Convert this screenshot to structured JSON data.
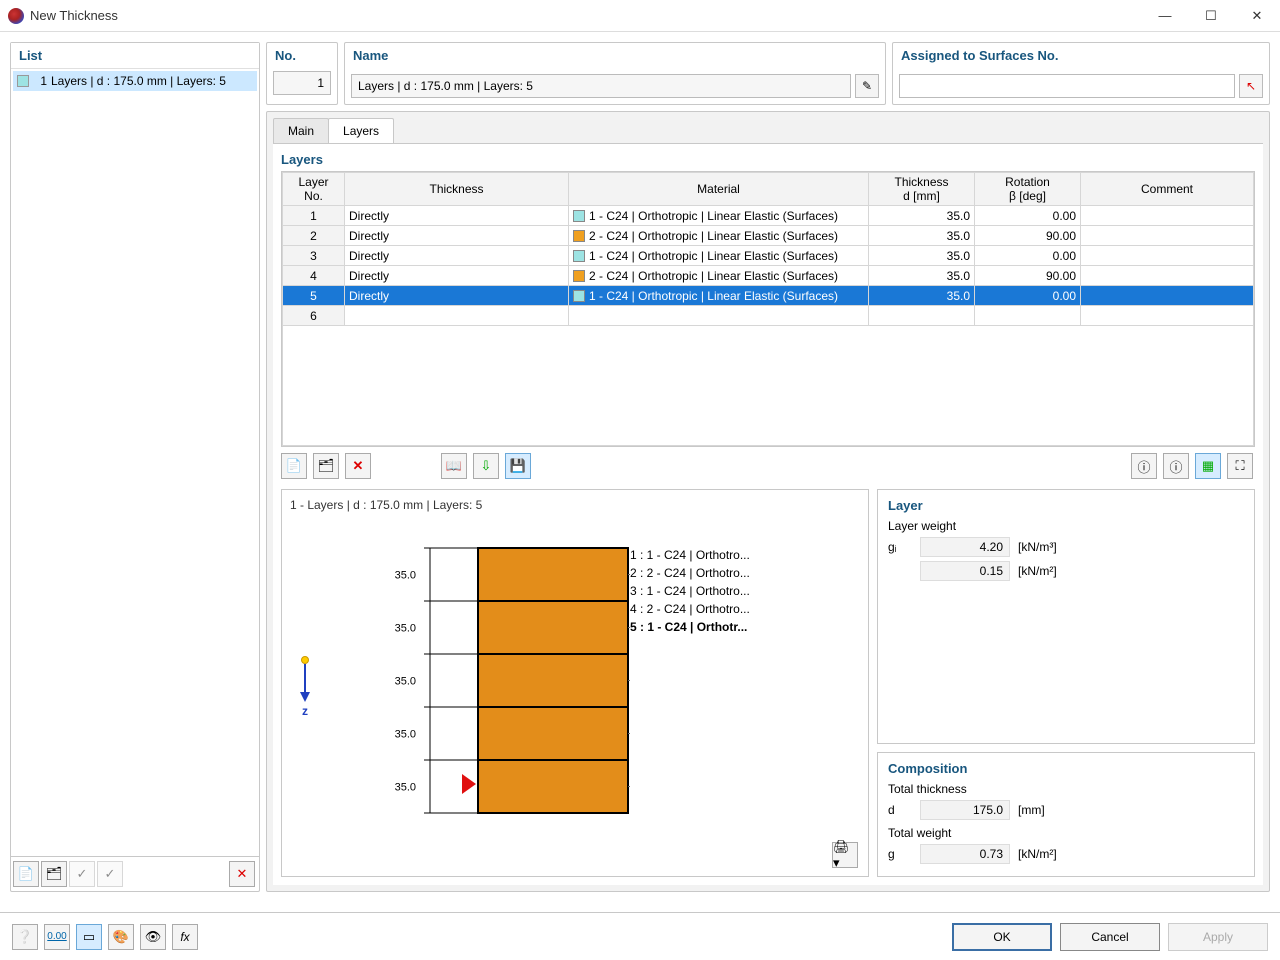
{
  "window": {
    "title": "New Thickness"
  },
  "list": {
    "header": "List",
    "items": [
      {
        "num": "1",
        "label": "Layers | d : 175.0 mm | Layers: 5"
      }
    ]
  },
  "no": {
    "header": "No.",
    "value": "1"
  },
  "name": {
    "header": "Name",
    "value": "Layers | d : 175.0 mm | Layers: 5"
  },
  "assigned": {
    "header": "Assigned to Surfaces No.",
    "value": ""
  },
  "tabs": {
    "main": "Main",
    "layers": "Layers"
  },
  "layers": {
    "header": "Layers",
    "cols": {
      "no": "Layer\nNo.",
      "thickness": "Thickness",
      "material": "Material",
      "d": "Thickness\nd [mm]",
      "rot": "Rotation\nβ [deg]",
      "comment": "Comment"
    },
    "rows": [
      {
        "no": "1",
        "thk": "Directly",
        "mat_sw": "c1",
        "mat": "1 - C24 | Orthotropic | Linear Elastic (Surfaces)",
        "d": "35.0",
        "rot": "0.00",
        "cmt": ""
      },
      {
        "no": "2",
        "thk": "Directly",
        "mat_sw": "c2",
        "mat": "2 - C24 | Orthotropic | Linear Elastic (Surfaces)",
        "d": "35.0",
        "rot": "90.00",
        "cmt": ""
      },
      {
        "no": "3",
        "thk": "Directly",
        "mat_sw": "c1",
        "mat": "1 - C24 | Orthotropic | Linear Elastic (Surfaces)",
        "d": "35.0",
        "rot": "0.00",
        "cmt": ""
      },
      {
        "no": "4",
        "thk": "Directly",
        "mat_sw": "c2",
        "mat": "2 - C24 | Orthotropic | Linear Elastic (Surfaces)",
        "d": "35.0",
        "rot": "90.00",
        "cmt": ""
      },
      {
        "no": "5",
        "thk": "Directly",
        "mat_sw": "c1",
        "mat": "1 - C24 | Orthotropic | Linear Elastic (Surfaces)",
        "d": "35.0",
        "rot": "0.00",
        "cmt": ""
      },
      {
        "no": "6",
        "thk": "",
        "mat_sw": "",
        "mat": "",
        "d": "",
        "rot": "",
        "cmt": ""
      }
    ],
    "selected_index": 4
  },
  "diagram": {
    "title": "1 - Layers | d : 175.0 mm | Layers: 5",
    "dims": [
      "35.0",
      "35.0",
      "35.0",
      "35.0",
      "35.0"
    ],
    "labels": [
      "1 : 1 - C24 | Orthotro...",
      "2 : 2 - C24 | Orthotro...",
      "3 : 1 - C24 | Orthotro...",
      "4 : 2 - C24 | Orthotro...",
      "5 : 1 - C24 | Orthotr..."
    ],
    "z_label": "z"
  },
  "layer_info": {
    "header": "Layer",
    "weight_label": "Layer weight",
    "gi_sym": "gᵢ",
    "gi_val": "4.20",
    "gi_unit": "[kN/m³]",
    "gi2_val": "0.15",
    "gi2_unit": "[kN/m²]"
  },
  "composition": {
    "header": "Composition",
    "thk_label": "Total thickness",
    "d_sym": "d",
    "d_val": "175.0",
    "d_unit": "[mm]",
    "w_label": "Total weight",
    "g_sym": "g",
    "g_val": "0.73",
    "g_unit": "[kN/m²]"
  },
  "buttons": {
    "ok": "OK",
    "cancel": "Cancel",
    "apply": "Apply"
  }
}
